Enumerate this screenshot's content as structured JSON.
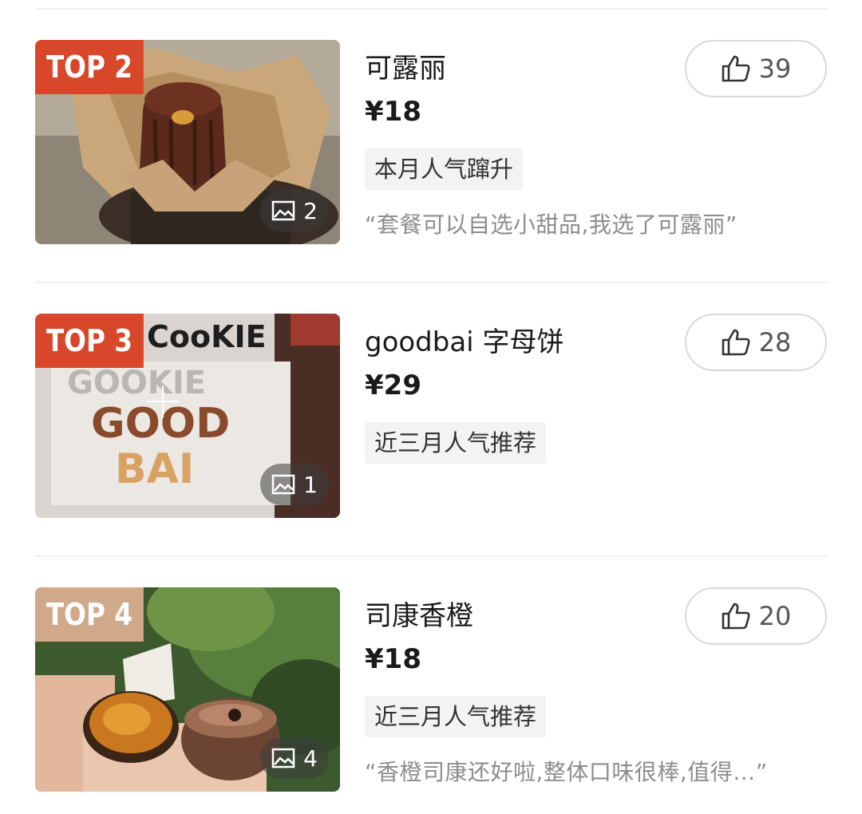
{
  "items": [
    {
      "rank": "TOP 2",
      "rank_color": "#d9472b",
      "name": "可露丽",
      "price": "¥18",
      "tag": "本月人气蹿升",
      "quote": "“套餐可以自选小甜品,我选了可露丽”",
      "photo_count": "2",
      "likes": "39"
    },
    {
      "rank": "TOP 3",
      "rank_color": "#d9472b",
      "name": "goodbai 字母饼",
      "price": "¥29",
      "tag": "近三月人气推荐",
      "quote": "",
      "photo_count": "1",
      "likes": "28"
    },
    {
      "rank": "TOP 4",
      "rank_color": "#cfa989",
      "name": "司康香橙",
      "price": "¥18",
      "tag": "近三月人气推荐",
      "quote": "“香橙司康还好啦,整体口味很棒,值得…”",
      "photo_count": "4",
      "likes": "20"
    }
  ],
  "icons": {
    "like": "thumbs-up-icon",
    "photos": "image-icon"
  }
}
